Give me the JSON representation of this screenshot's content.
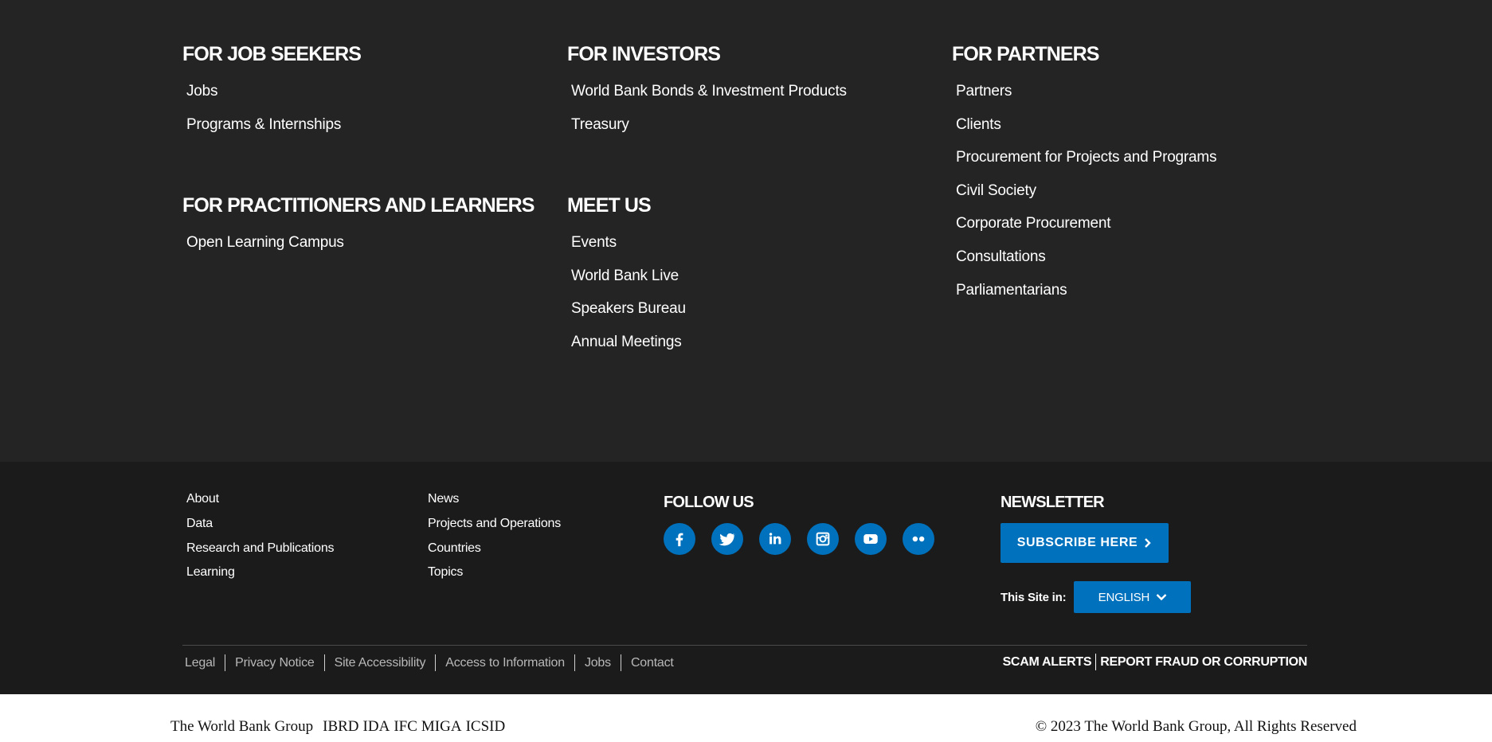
{
  "top_footer": {
    "job_seekers": {
      "heading": "FOR JOB SEEKERS",
      "links": [
        "Jobs",
        "Programs & Internships"
      ]
    },
    "practitioners": {
      "heading": "FOR PRACTITIONERS AND LEARNERS",
      "links": [
        "Open Learning Campus"
      ]
    },
    "investors": {
      "heading": "FOR INVESTORS",
      "links": [
        "World Bank Bonds & Investment Products",
        "Treasury"
      ]
    },
    "meet_us": {
      "heading": "MEET US",
      "links": [
        "Events",
        "World Bank Live",
        "Speakers Bureau",
        "Annual Meetings"
      ]
    },
    "partners": {
      "heading": "FOR PARTNERS",
      "links": [
        "Partners",
        "Clients",
        "Procurement for Projects and Programs",
        "Civil Society",
        "Corporate Procurement",
        "Consultations",
        "Parliamentarians"
      ]
    }
  },
  "bottom_footer": {
    "quick_links_1": [
      "About",
      "Data",
      "Research and Publications",
      "Learning"
    ],
    "quick_links_2": [
      "News",
      "Projects and Operations",
      "Countries",
      "Topics"
    ],
    "follow_us": {
      "title": "FOLLOW US",
      "networks": [
        {
          "name": "facebook",
          "icon": "facebook-icon"
        },
        {
          "name": "twitter",
          "icon": "twitter-icon"
        },
        {
          "name": "linkedin",
          "icon": "linkedin-icon"
        },
        {
          "name": "instagram",
          "icon": "instagram-icon"
        },
        {
          "name": "youtube",
          "icon": "youtube-icon"
        },
        {
          "name": "flickr",
          "icon": "flickr-icon"
        }
      ]
    },
    "newsletter": {
      "title": "NEWSLETTER",
      "subscribe_label": "SUBSCRIBE HERE",
      "site_in_label": "This Site in:",
      "language": "ENGLISH"
    },
    "legal_links": [
      "Legal",
      "Privacy Notice",
      "Site Accessibility",
      "Access to Information",
      "Jobs",
      "Contact"
    ],
    "alerts": [
      "SCAM ALERTS",
      "REPORT FRAUD OR CORRUPTION"
    ]
  },
  "copyright_strip": {
    "group_name": "The World Bank Group",
    "orgs": [
      "IBRD",
      "IDA",
      "IFC",
      "MIGA",
      "ICSID"
    ],
    "copyright": "© 2023 The World Bank Group, All Rights Reserved"
  },
  "colors": {
    "top_bg": "#242424",
    "bottom_bg": "#1b1b1b",
    "accent_blue": "#0071bc",
    "text_white": "#ffffff",
    "muted_text": "#b8b8b8"
  }
}
